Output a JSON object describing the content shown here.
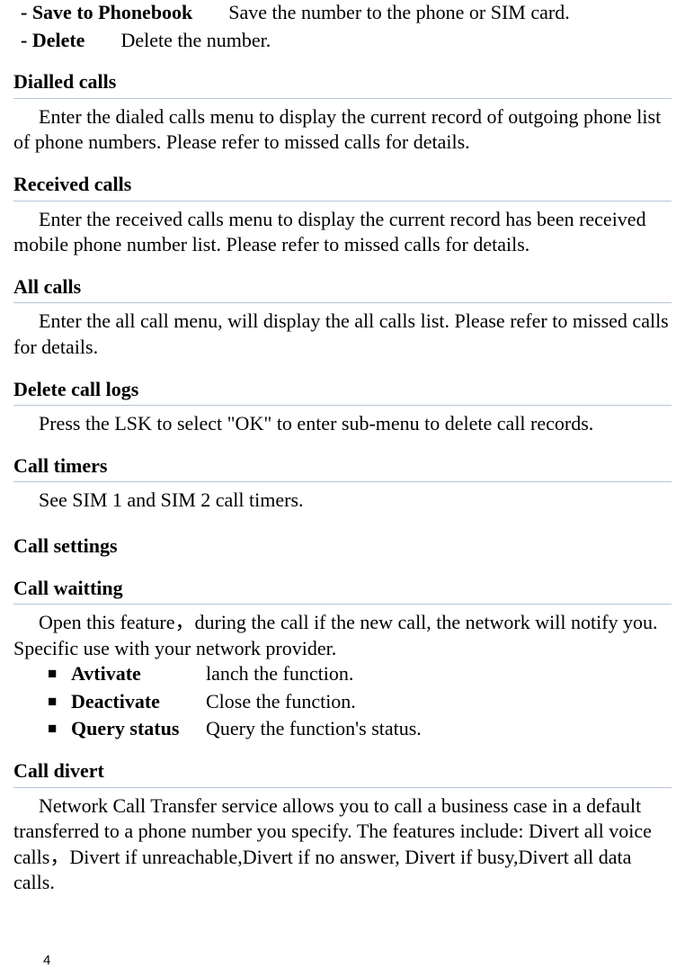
{
  "options": {
    "save": {
      "label": "- Save to Phonebook",
      "desc": "Save the number to the phone or SIM card."
    },
    "del": {
      "label": "- Delete",
      "desc": "Delete the number."
    }
  },
  "sections": {
    "dialled": {
      "heading": "Dialled calls",
      "para": "Enter the dialed calls menu to display the current record of outgoing phone list of phone numbers. Please refer to missed calls for details."
    },
    "received": {
      "heading": "Received calls",
      "para": "Enter the received calls menu to display the current record has been received mobile phone number list. Please refer to missed calls for details."
    },
    "all": {
      "heading": "All calls",
      "para": "Enter the all call menu, will display the all calls list. Please refer to missed calls for details."
    },
    "delLogs": {
      "heading": "Delete call logs",
      "para": "Press the LSK to select \"OK\" to enter sub-menu to delete call records."
    },
    "timers": {
      "heading": "Call timers",
      "para": "See SIM 1 and SIM 2 call timers."
    }
  },
  "callSettings": {
    "heading": "Call settings",
    "waiting": {
      "heading": "Call waitting",
      "para": "Open this feature，during the call if the new call, the network will notify you. Specific use with your network provider.",
      "items": {
        "activate": {
          "label": "Avtivate",
          "desc": "lanch the function."
        },
        "deactivate": {
          "label": "Deactivate",
          "desc": "Close the function."
        },
        "query": {
          "label": "Query status",
          "desc": "Query the function's status."
        }
      }
    },
    "divert": {
      "heading": "Call divert",
      "para": "Network Call Transfer service allows you to call a business case in a default transferred to a phone number you specify. The features include: Divert all voice calls，Divert if unreachable,Divert if no answer, Divert if busy,Divert all data calls."
    }
  },
  "page": "4"
}
